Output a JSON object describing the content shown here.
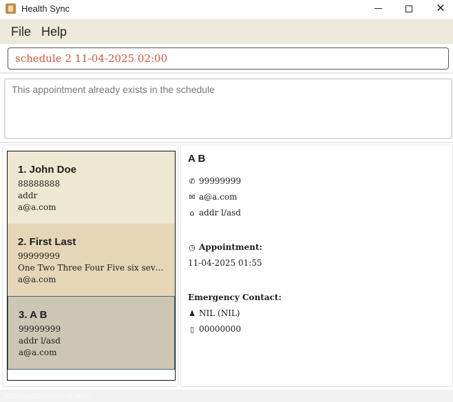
{
  "window": {
    "title": "Health Sync",
    "controls": {
      "minimize": "minimize-icon",
      "maximize": "maximize-icon",
      "close": "✕"
    }
  },
  "menu": {
    "file": "File",
    "help": "Help"
  },
  "command": {
    "value": "schedule 2 11-04-2025 02:00"
  },
  "result": {
    "message": "This appointment already exists in the schedule"
  },
  "persons": [
    {
      "name": "1. John Doe",
      "phone": "88888888",
      "address": "addr",
      "email": "a@a.com"
    },
    {
      "name": "2. First Last",
      "phone": "99999999",
      "address": "One Two Three Four Five six seven eight",
      "email": "a@a.com"
    },
    {
      "name": "3. A B",
      "phone": "99999999",
      "address": "addr l/asd",
      "email": "a@a.com"
    }
  ],
  "detail": {
    "name": "A B",
    "phone": "99999999",
    "email": "a@a.com",
    "address": "addr l/asd",
    "appointment_label": "Appointment:",
    "appointment": "11-04-2025 01:55",
    "emergency_label": "Emergency Contact:",
    "emergency_name": "NIL  (NIL)",
    "emergency_phone": "00000000",
    "icons": {
      "phone": "phone-icon",
      "email": "mail-icon",
      "address": "home-icon",
      "appointment": "clock-icon",
      "person": "person-icon",
      "mobile": "mobile-icon"
    }
  },
  "status": {
    "path": ".\\data\\addressbook.json"
  },
  "colors": {
    "accent_text": "#d2553b",
    "selected_card": "#ccc7b5",
    "menu_bg": "#eeeadb"
  }
}
